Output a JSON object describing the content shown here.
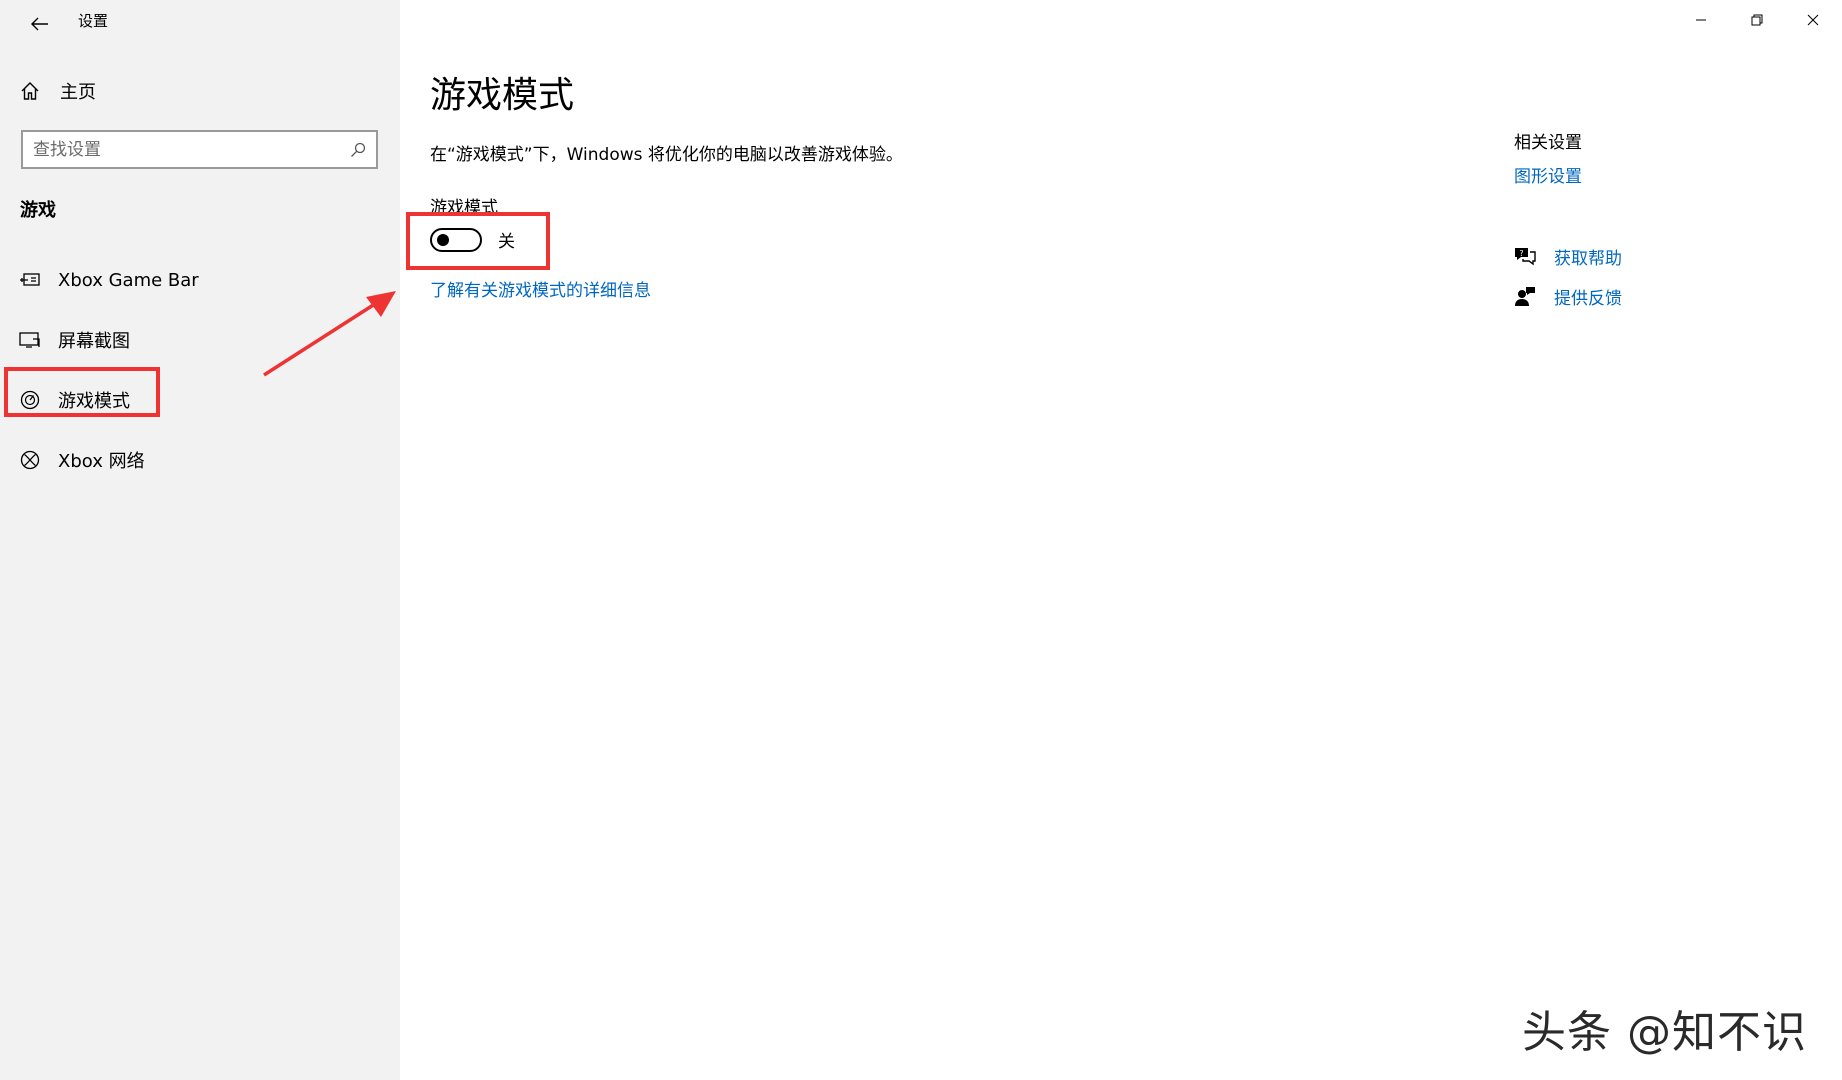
{
  "titlebar": {
    "app_title": "设置"
  },
  "sidebar": {
    "home_label": "主页",
    "search_placeholder": "查找设置",
    "section_title": "游戏",
    "items": [
      {
        "label": "Xbox Game Bar",
        "icon": "gamebar-icon"
      },
      {
        "label": "屏幕截图",
        "icon": "capture-icon"
      },
      {
        "label": "游戏模式",
        "icon": "game-mode-icon",
        "selected": true
      },
      {
        "label": "Xbox 网络",
        "icon": "xbox-icon"
      }
    ]
  },
  "main": {
    "title": "游戏模式",
    "description": "在“游戏模式”下，Windows 将优化你的电脑以改善游戏体验。",
    "toggle_label": "游戏模式",
    "toggle_state": "关",
    "toggle_on": false,
    "learn_more_link": "了解有关游戏模式的详细信息"
  },
  "related": {
    "title": "相关设置",
    "graphics_link": "图形设置",
    "help_link": "获取帮助",
    "feedback_link": "提供反馈"
  },
  "watermark": "头条 @知不识",
  "colors": {
    "accent": "#0067c0",
    "highlight": "#ee3333",
    "sidebar_bg": "#f2f2f2"
  }
}
